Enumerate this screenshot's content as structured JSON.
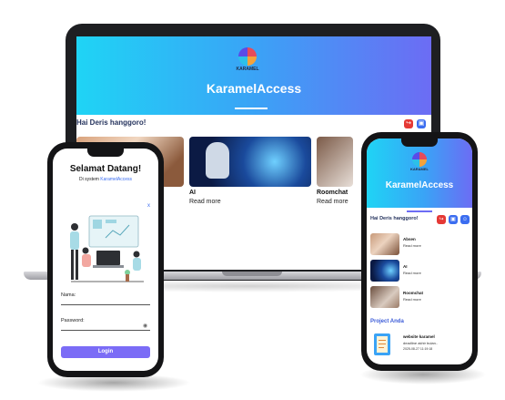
{
  "app": {
    "brand": "KARAMEL",
    "title": "KaramelAccess"
  },
  "laptop": {
    "greeting": "Hai Deris hanggoro!",
    "cards": [
      {
        "title": "AI",
        "link": "Read more"
      },
      {
        "title": "Roomchat",
        "link": "Read more"
      }
    ]
  },
  "login": {
    "heading": "Selamat Datang!",
    "subtitle_prefix": "Di system ",
    "subtitle_brand": "KaramelAccess",
    "name_label": "Nama:",
    "password_label": "Password:",
    "login_button": "Login",
    "close_mark": "x",
    "colors": {
      "button": "#7b6cf6",
      "brand": "#3b6df0"
    }
  },
  "mobile": {
    "greeting": "Hai Deris hanggoro!",
    "items": [
      {
        "title": "Absen",
        "link": "Read more"
      },
      {
        "title": "AI",
        "link": "Read more"
      },
      {
        "title": "Roomchat",
        "link": "Read more"
      }
    ],
    "projects_heading": "Project Anda",
    "project": {
      "title": "website karamel",
      "deadline": "deadline akhir bulan..",
      "date": "2025-08-27 11:19:18"
    }
  },
  "icons": {
    "logout": "logout-icon",
    "save": "save-icon",
    "user": "user-icon",
    "eye": "eye-icon"
  },
  "colors": {
    "gradient_start": "#1fd4f5",
    "gradient_end": "#6c6cf4",
    "red_button": "#e53935",
    "blue_button": "#3b6df0"
  }
}
